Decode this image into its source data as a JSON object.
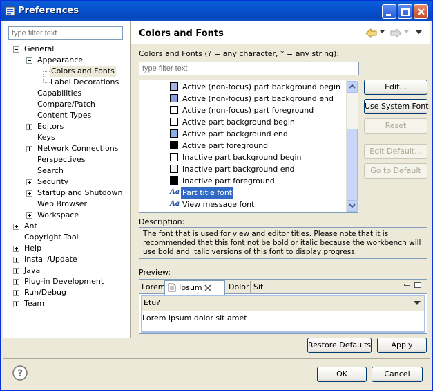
{
  "window": {
    "title": "Preferences",
    "colors": {
      "titlebar": "#0752d0",
      "selection": "#316ac5"
    }
  },
  "left": {
    "filter_placeholder": "type filter text",
    "tree": {
      "general": "General",
      "appearance": "Appearance",
      "colors_and_fonts": "Colors and Fonts",
      "label_decorations": "Label Decorations",
      "capabilities": "Capabilities",
      "compare_patch": "Compare/Patch",
      "content_types": "Content Types",
      "editors": "Editors",
      "keys": "Keys",
      "network_connections": "Network Connections",
      "perspectives": "Perspectives",
      "search": "Search",
      "security": "Security",
      "startup_shutdown": "Startup and Shutdown",
      "web_browser": "Web Browser",
      "workspace": "Workspace",
      "ant": "Ant",
      "copyright_tool": "Copyright Tool",
      "help": "Help",
      "install_update": "Install/Update",
      "java": "Java",
      "plugin_development": "Plug-in Development",
      "run_debug": "Run/Debug",
      "team": "Team"
    }
  },
  "main": {
    "title": "Colors and Fonts",
    "subtitle": "Colors and Fonts (? = any character, * = any string):",
    "filter_placeholder": "type filter text",
    "items": [
      {
        "label": "Active (non-focus) part background begin",
        "kind": "color",
        "color": "#a6b4e0"
      },
      {
        "label": "Active (non-focus) part background end",
        "kind": "color",
        "color": "#8c9cdc"
      },
      {
        "label": "Active (non-focus) part foreground",
        "kind": "color",
        "color": "#ffffff"
      },
      {
        "label": "Active part background begin",
        "kind": "color",
        "color": "#ffffff"
      },
      {
        "label": "Active part background end",
        "kind": "color",
        "color": "#8caee6"
      },
      {
        "label": "Active part foreground",
        "kind": "color",
        "color": "#000000"
      },
      {
        "label": "Inactive part background begin",
        "kind": "color",
        "color": "#ffffff"
      },
      {
        "label": "Inactive part background end",
        "kind": "color",
        "color": "#ece9d8"
      },
      {
        "label": "Inactive part foreground",
        "kind": "color",
        "color": "#000000"
      },
      {
        "label": "Part title font",
        "kind": "font",
        "icon": "Aa",
        "selected": true
      },
      {
        "label": "View message font",
        "kind": "font",
        "icon": "Aa"
      }
    ],
    "buttons": {
      "edit": "Edit...",
      "use_system_font": "Use System Font",
      "reset": "Reset",
      "edit_default": "Edit Default...",
      "go_to_default": "Go to Default"
    },
    "description_label": "Description:",
    "description": "The font that is used for view and editor titles.  Please note that it is recommended that this font not be bold or italic because the workbench will use bold and italic versions of this font to display progress.",
    "preview_label": "Preview:",
    "preview": {
      "tabs": [
        "Lorem",
        "Ipsum",
        "Dolor",
        "Sit"
      ],
      "combo_value": "Etu?",
      "body_text": "Lorem ipsum dolor sit amet"
    },
    "restore_defaults": "Restore Defaults",
    "apply": "Apply"
  },
  "footer": {
    "ok": "OK",
    "cancel": "Cancel"
  }
}
